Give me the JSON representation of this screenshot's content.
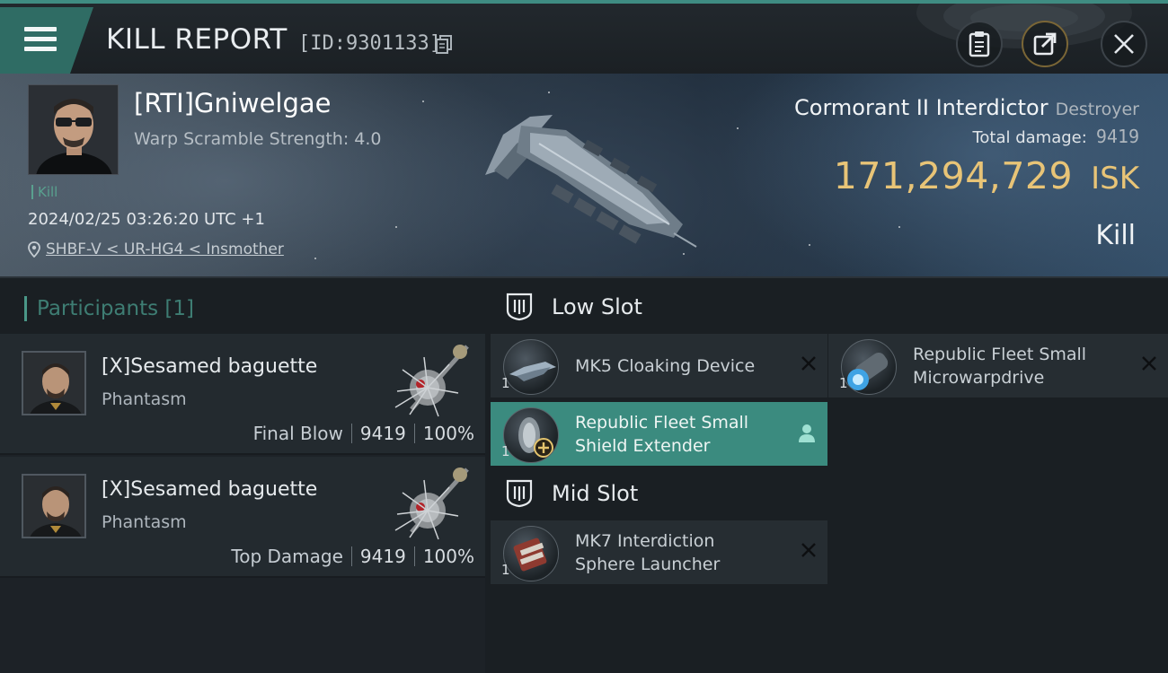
{
  "header": {
    "title": "KILL REPORT",
    "report_id": "[ID:9301133]"
  },
  "victim": {
    "name": "[RTI]Gniwelgae",
    "warp_scramble": "Warp Scramble Strength: 4.0",
    "tag": "Kill",
    "datetime": "2024/02/25 03:26:20 UTC +1",
    "location": "SHBF-V < UR-HG4 < Insmother"
  },
  "ship": {
    "name": "Cormorant II Interdictor",
    "class": "Destroyer",
    "total_damage_label": "Total damage:",
    "total_damage": "9419",
    "isk_value": "171,294,729",
    "isk_unit": "ISK",
    "result": "Kill"
  },
  "participants": {
    "title": "Participants [1]",
    "items": [
      {
        "name": "[X]Sesamed baguette",
        "ship": "Phantasm",
        "label": "Final Blow",
        "damage": "9419",
        "percent": "100%"
      },
      {
        "name": "[X]Sesamed baguette",
        "ship": "Phantasm",
        "label": "Top Damage",
        "damage": "9419",
        "percent": "100%"
      }
    ]
  },
  "slots": {
    "low": {
      "title": "Low Slot",
      "modules": [
        {
          "line1": "MK5 Cloaking Device",
          "line2": "",
          "qty": "1"
        },
        {
          "line1": "Republic Fleet Small",
          "line2": "Microwarpdrive",
          "qty": "1"
        },
        {
          "line1": "Republic Fleet Small",
          "line2": "Shield Extender",
          "qty": "1"
        }
      ]
    },
    "mid": {
      "title": "Mid Slot",
      "modules": [
        {
          "line1": "MK7 Interdiction",
          "line2": "Sphere Launcher",
          "qty": "1"
        }
      ]
    }
  },
  "colors": {
    "accent": "#3b8b7f",
    "isk": "#e8c477",
    "kill_tag": "#59a18f"
  }
}
